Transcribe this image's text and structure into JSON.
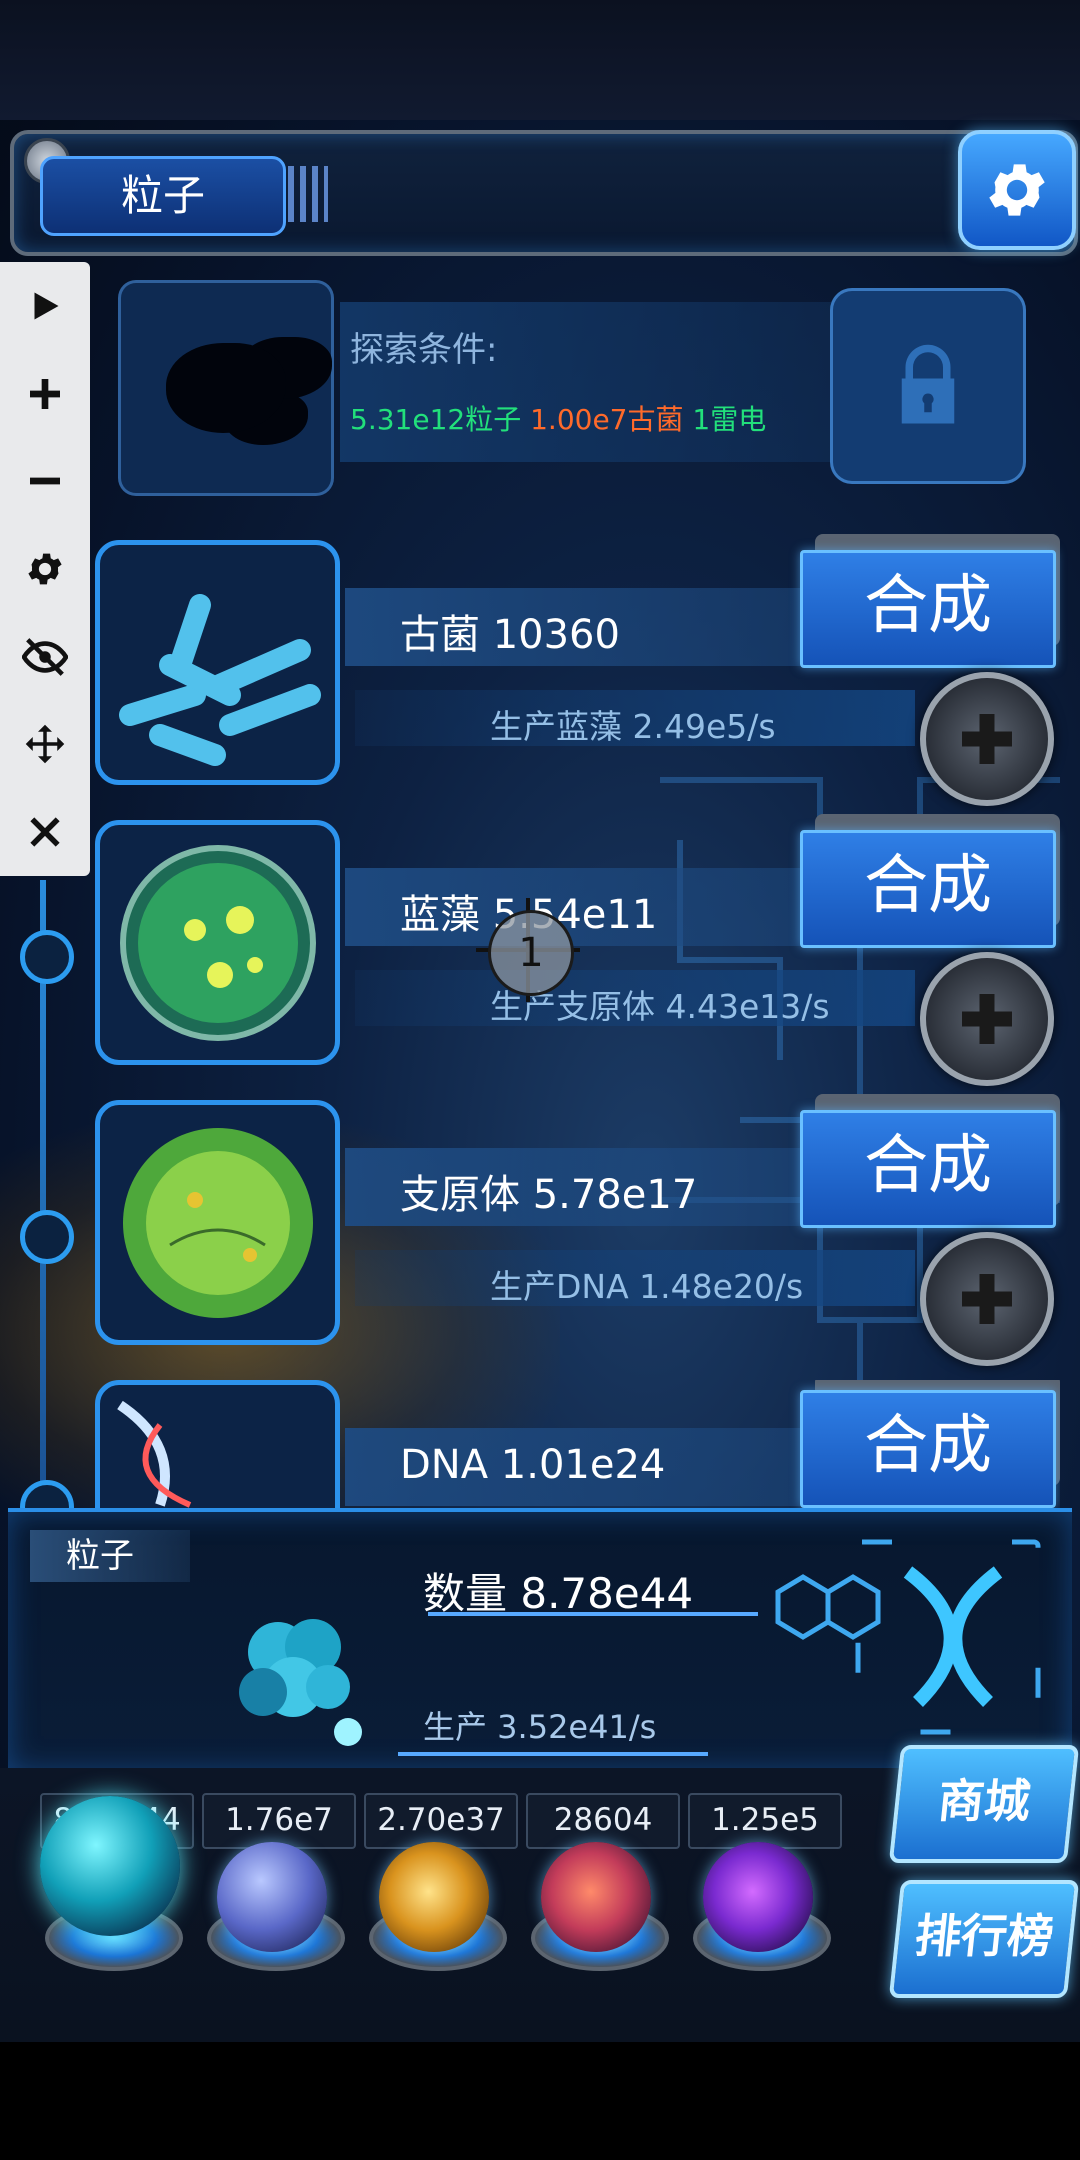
{
  "header": {
    "title": "粒子",
    "settings_icon": "gear-icon"
  },
  "toolbar": {
    "items": [
      "play-icon",
      "plus-icon",
      "minus-icon",
      "gear-icon",
      "eye-off-icon",
      "move-icon",
      "close-icon"
    ]
  },
  "unlock": {
    "title": "探索条件:",
    "req_a": "5.31e12粒子",
    "req_b": "1.00e7古菌",
    "req_c": "1雷电",
    "lock_icon": "lock-icon"
  },
  "items": [
    {
      "name": "古菌 10360",
      "production": "生产蓝藻 2.49e5/s",
      "synth_label": "合成",
      "icon": "bacteria-rods-icon"
    },
    {
      "name": "蓝藻 5.54e11",
      "production": "生产支原体 4.43e13/s",
      "synth_label": "合成",
      "icon": "green-cell-icon"
    },
    {
      "name": "支原体 5.78e17",
      "production": "生产DNA 1.48e20/s",
      "synth_label": "合成",
      "icon": "mycoplasma-icon"
    },
    {
      "name": "DNA 1.01e24",
      "synth_label": "合成",
      "icon": "dna-icon"
    }
  ],
  "crosshair": {
    "label": "1"
  },
  "particle": {
    "title": "粒子",
    "count": "数量 8.78e44",
    "rate": "生产 3.52e41/s"
  },
  "resources": {
    "values": [
      "8.78e44",
      "1.76e7",
      "2.70e37",
      "28604",
      "1.25e5"
    ],
    "orbs": [
      "particle-orb-icon",
      "lightning-orb-icon",
      "galaxy-orb-icon",
      "brain-orb-icon",
      "vortex-orb-icon"
    ]
  },
  "side_buttons": {
    "shop": "商城",
    "ranking": "排行榜"
  }
}
